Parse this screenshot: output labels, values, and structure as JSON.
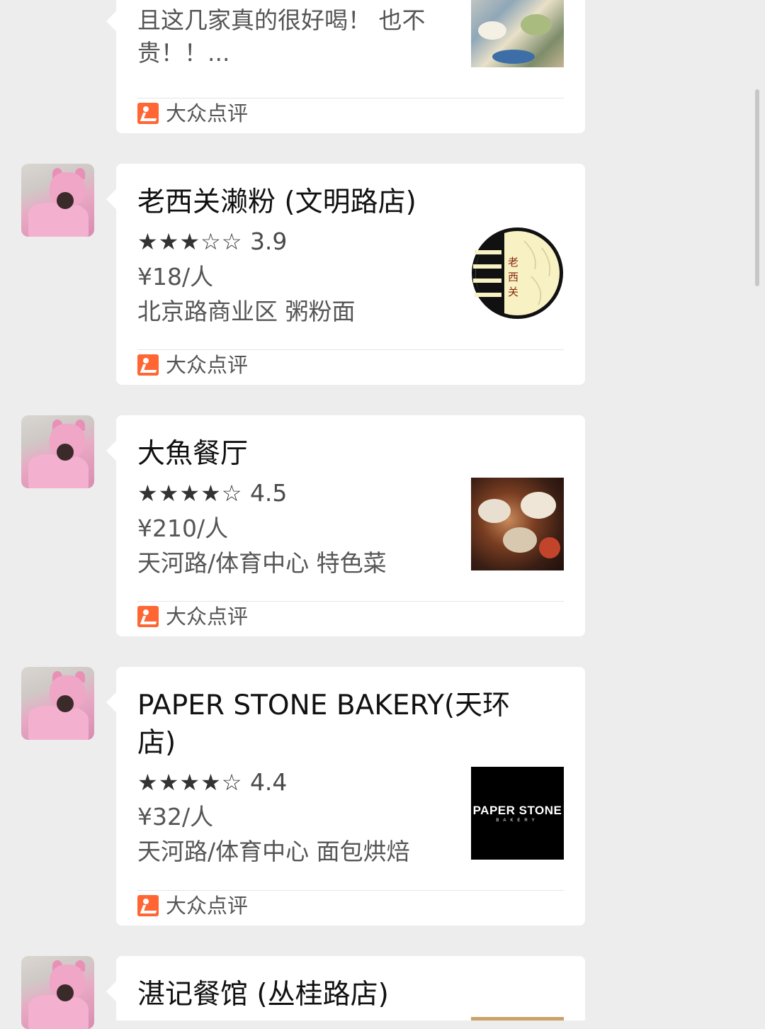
{
  "top_card": {
    "snippet_line1": "且这几家真的很好喝！ 也不",
    "snippet_line2": "贵！！...",
    "source": "大众点评"
  },
  "cards": [
    {
      "title": "老西关濑粉 (文明路店)",
      "stars": "★★★☆☆",
      "rating": "3.9",
      "price": "¥18/人",
      "area": "北京路商业区 粥粉面",
      "source": "大众点评",
      "logo_text": "老西关"
    },
    {
      "title": "大魚餐厅",
      "stars": "★★★★☆",
      "rating": "4.5",
      "price": "¥210/人",
      "area": "天河路/体育中心 特色菜",
      "source": "大众点评"
    },
    {
      "title": "PAPER STONE BAKERY(天环店)",
      "stars": "★★★★☆",
      "rating": "4.4",
      "price": "¥32/人",
      "area": "天河路/体育中心 面包烘焙",
      "source": "大众点评",
      "logo_text": "PAPER STONE",
      "logo_sub": "BAKERY"
    },
    {
      "title": "湛记餐馆 (丛桂路店)"
    }
  ],
  "colors": {
    "background": "#ededed",
    "card": "#ffffff",
    "dianping_orange": "#ff6633"
  }
}
